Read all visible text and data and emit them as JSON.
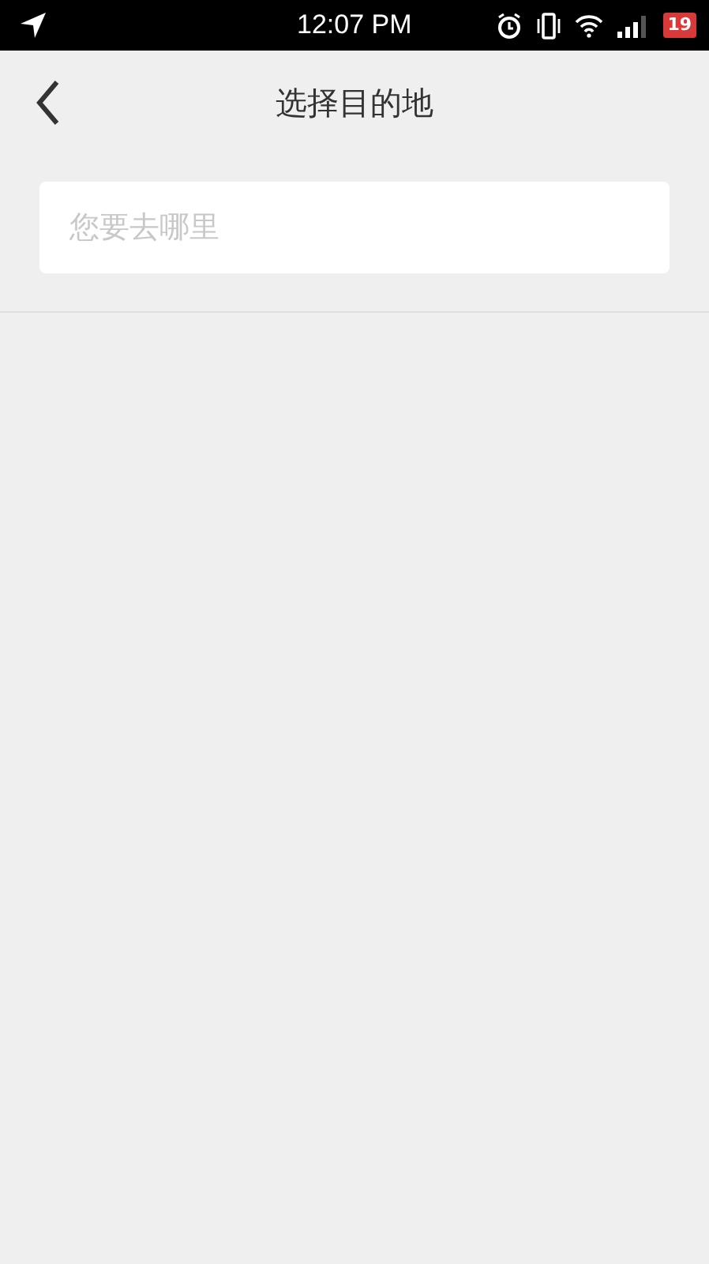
{
  "status_bar": {
    "time": "12:07 PM",
    "battery": "19"
  },
  "header": {
    "title": "选择目的地"
  },
  "search": {
    "placeholder": "您要去哪里"
  }
}
